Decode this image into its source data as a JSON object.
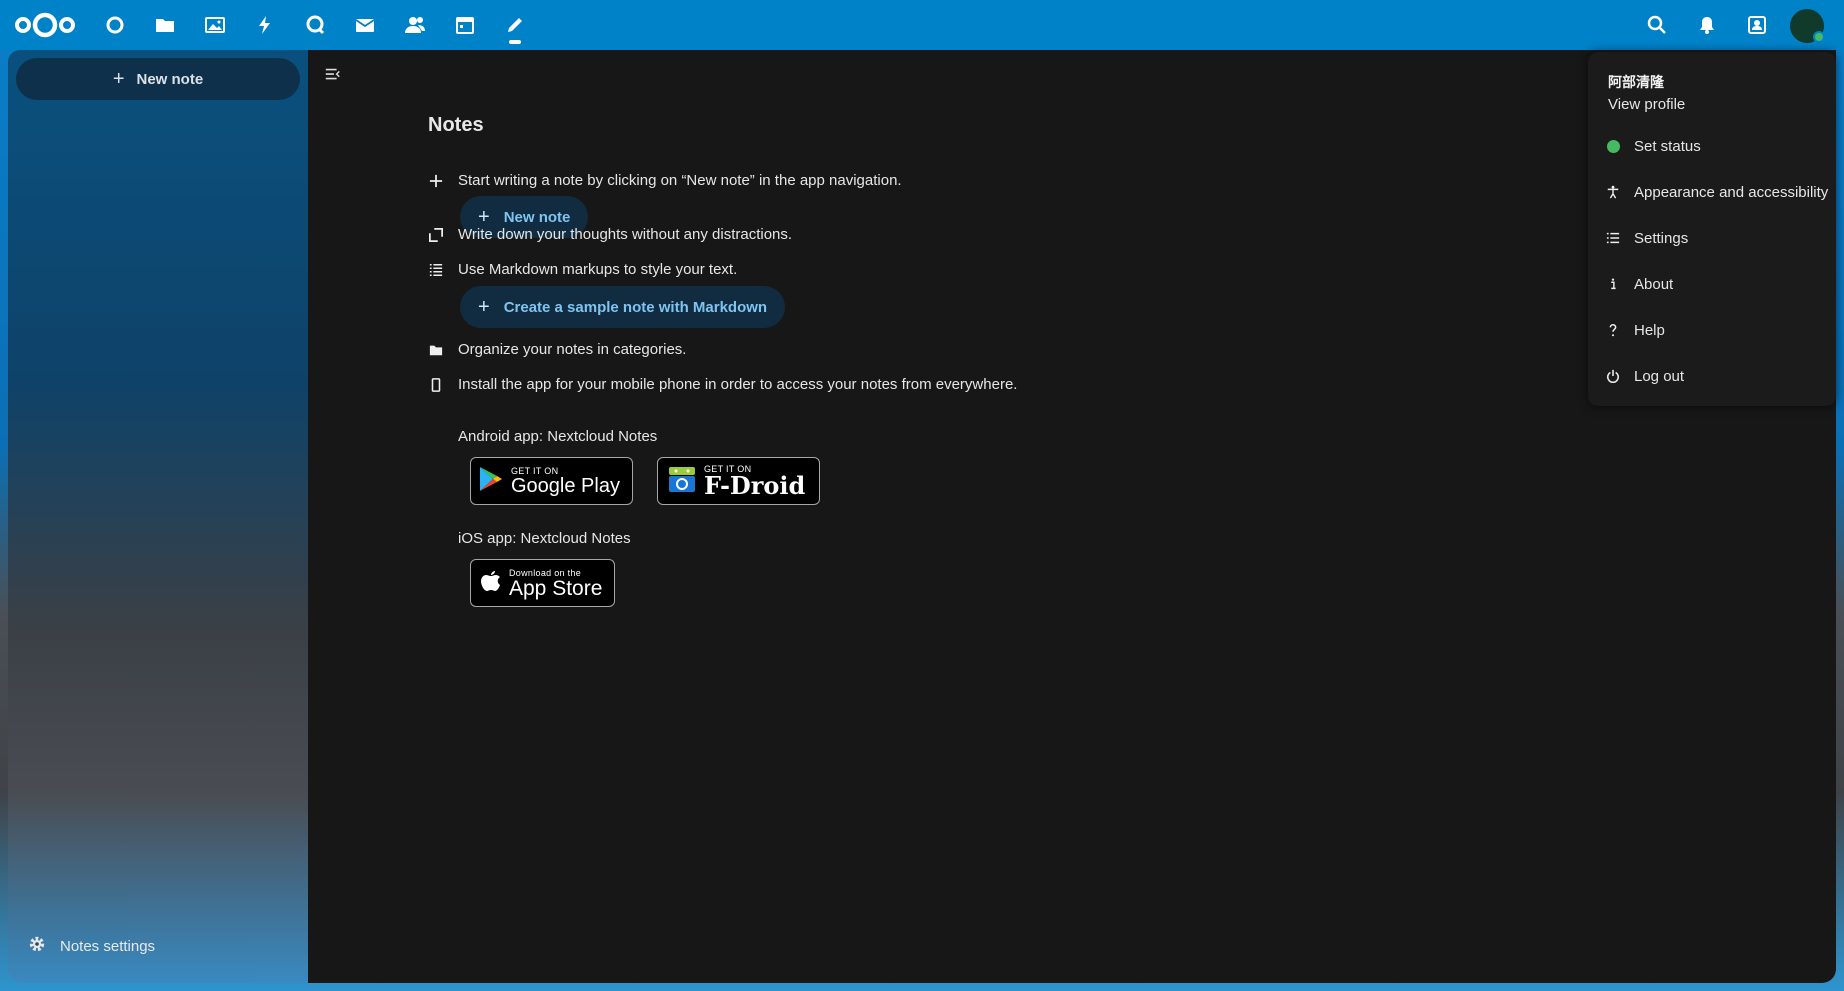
{
  "topbar": {
    "apps": [
      {
        "name": "dashboard-icon"
      },
      {
        "name": "files-icon"
      },
      {
        "name": "photos-icon"
      },
      {
        "name": "activity-icon"
      },
      {
        "name": "talk-icon"
      },
      {
        "name": "mail-icon"
      },
      {
        "name": "contacts-icon"
      },
      {
        "name": "calendar-icon"
      },
      {
        "name": "notes-icon",
        "active": true
      }
    ],
    "right_icons": [
      "search-icon",
      "notifications-icon",
      "contacts-menu-icon"
    ],
    "accent": "#0082c9"
  },
  "sidebar": {
    "new_note_label": "New note",
    "settings_label": "Notes settings"
  },
  "main": {
    "title": "Notes",
    "lines": [
      "Start writing a note by clicking on “New note” in the app navigation.",
      "Write down your thoughts without any distractions.",
      "Use Markdown markups to style your text.",
      "Organize your notes in categories.",
      "Install the app for your mobile phone in order to access your notes from everywhere."
    ],
    "new_note_button": "New note",
    "sample_button": "Create a sample note with Markdown",
    "android_label": "Android app: Nextcloud Notes",
    "ios_label": "iOS app: Nextcloud Notes",
    "badges": {
      "google_small": "GET IT ON",
      "google_big": "Google Play",
      "fdroid_small": "GET IT ON",
      "fdroid_big": "F-Droid",
      "apple_small": "Download on the",
      "apple_big": "App Store"
    }
  },
  "user_menu": {
    "username": "阿部清隆",
    "view_profile": "View profile",
    "items": [
      "Set status",
      "Appearance and accessibility",
      "Settings",
      "About",
      "Help",
      "Log out"
    ],
    "status_color": "#46ba61"
  }
}
